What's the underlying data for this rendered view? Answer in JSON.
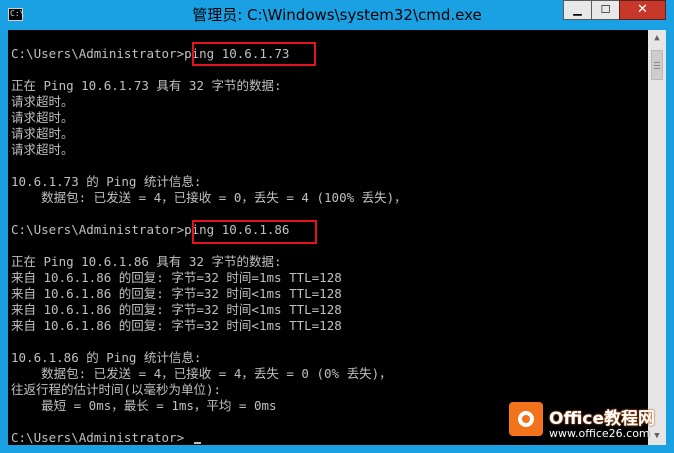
{
  "window": {
    "title": "管理员: C:\\Windows\\system32\\cmd.exe",
    "icon": "cmd-icon",
    "controls": {
      "minimize": "▁",
      "maximize": "☐",
      "close": "✕"
    }
  },
  "console": {
    "lines": [
      "C:\\Users\\Administrator>ping 10.6.1.73",
      "",
      "正在 Ping 10.6.1.73 具有 32 字节的数据:",
      "请求超时。",
      "请求超时。",
      "请求超时。",
      "请求超时。",
      "",
      "10.6.1.73 的 Ping 统计信息:",
      "    数据包: 已发送 = 4，已接收 = 0，丢失 = 4 (100% 丢失)，",
      "",
      "C:\\Users\\Administrator>ping 10.6.1.86",
      "",
      "正在 Ping 10.6.1.86 具有 32 字节的数据:",
      "来自 10.6.1.86 的回复: 字节=32 时间=1ms TTL=128",
      "来自 10.6.1.86 的回复: 字节=32 时间<1ms TTL=128",
      "来自 10.6.1.86 的回复: 字节=32 时间<1ms TTL=128",
      "来自 10.6.1.86 的回复: 字节=32 时间<1ms TTL=128",
      "",
      "10.6.1.86 的 Ping 统计信息:",
      "    数据包: 已发送 = 4，已接收 = 4，丢失 = 0 (0% 丢失)，",
      "往返行程的估计时间(以毫秒为单位):",
      "    最短 = 0ms，最长 = 1ms，平均 = 0ms",
      "",
      "C:\\Users\\Administrator>"
    ],
    "highlight_color": "#e0161c"
  },
  "watermark": {
    "brand": "Office教程网",
    "url": "www.office26.com"
  }
}
